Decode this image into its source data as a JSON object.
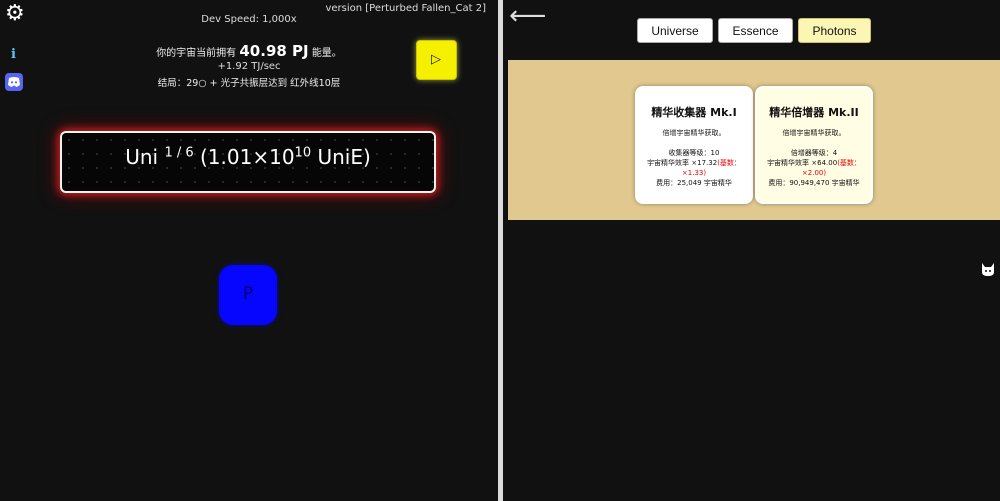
{
  "left": {
    "version": "version [Perturbed Fallen_Cat 2]",
    "dev_speed": "Dev Speed: 1,000x",
    "energy_prefix": "你的宇宙当前拥有",
    "energy_value": "40.98 PJ",
    "energy_suffix": "能量。",
    "rate": "+1.92 TJ/sec",
    "ending": "结局：29○ + 光子共振层达到 红外线10层",
    "info_label": "i",
    "yellow_button_glyph": "▷",
    "uni_base": "Uni",
    "uni_fraction": "1 / 6",
    "uni_paren_open": "(1.01×10",
    "uni_exponent": "10",
    "uni_paren_close": "UniE)",
    "p_button": "P"
  },
  "right": {
    "back_glyph": "⟵",
    "tabs": [
      {
        "label": "Universe",
        "active": false
      },
      {
        "label": "Essence",
        "active": false
      },
      {
        "label": "Photons",
        "active": true
      }
    ],
    "cards": [
      {
        "title": "精华收集器 Mk.I",
        "desc": "倍增宇宙精华获取。",
        "level": "收集器等级：10",
        "eff": "宇宙精华效率 ×17.32",
        "base": "(基数：×1.33)",
        "cost": "费用：25,049 宇宙精华"
      },
      {
        "title": "精华倍增器 Mk.II",
        "desc": "倍增宇宙精华获取。",
        "level": "倍增器等级：4",
        "eff": "宇宙精华效率 ×64.00",
        "base": "(基数：×2.00)",
        "cost": "费用：90,949,470 宇宙精华"
      }
    ]
  },
  "colors": {
    "background": "#111111",
    "glow_red": "#ff2828",
    "yellow_button": "#f5f000",
    "p_button": "#0606ff",
    "content_bg": "#e0c88e",
    "active_tab": "#fbf6b3"
  }
}
